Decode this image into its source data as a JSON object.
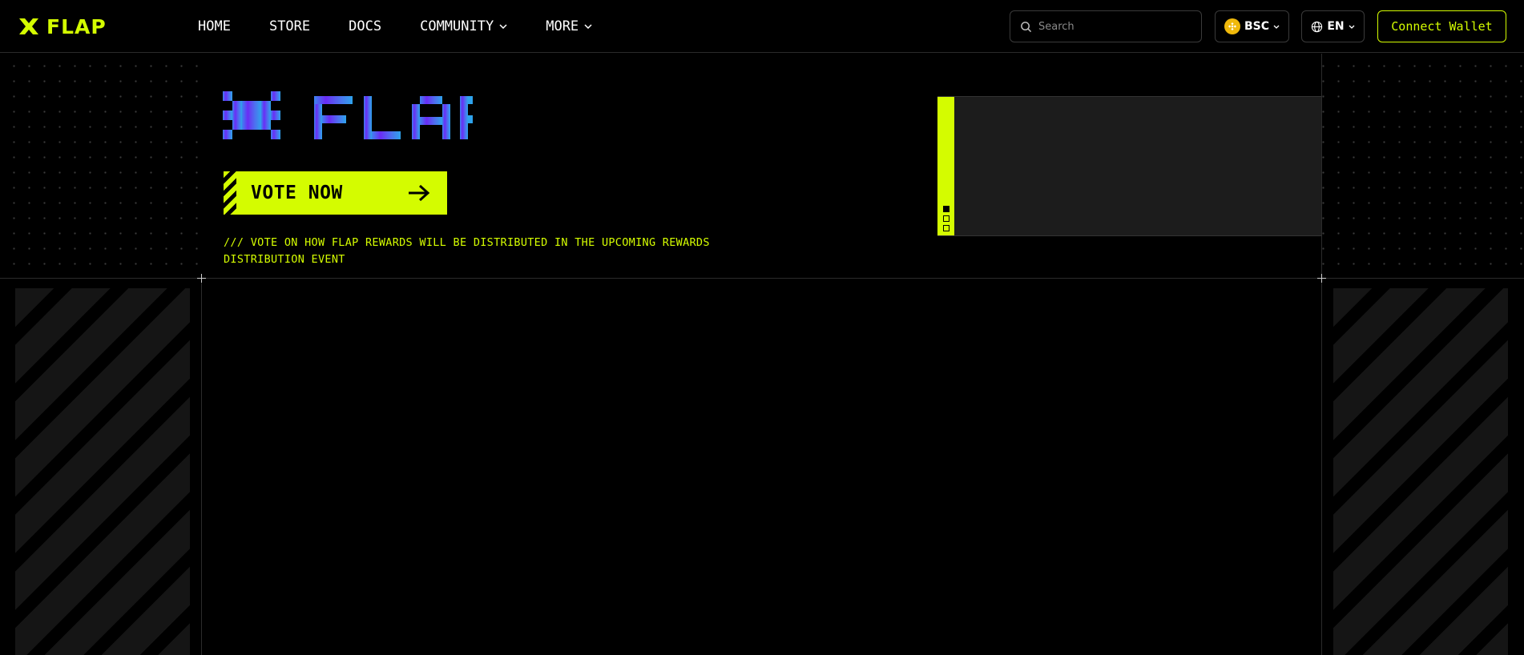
{
  "brand": {
    "name": "FLAP",
    "accent": "#d4fc00",
    "logo_icon": "flap-x-logo-icon"
  },
  "nav": {
    "links": [
      {
        "label": "HOME"
      },
      {
        "label": "STORE"
      },
      {
        "label": "DOCS"
      },
      {
        "label": "COMMUNITY",
        "dropdown": true
      },
      {
        "label": "MORE",
        "dropdown": true
      }
    ],
    "search_placeholder": "Search",
    "chain": {
      "label": "BSC",
      "icon": "bnb-chain-icon"
    },
    "language": {
      "label": "EN",
      "icon": "globe-icon"
    },
    "connect_label": "Connect Wallet"
  },
  "hero": {
    "title": "FLAP",
    "cta_label": "VOTE NOW",
    "cta_icon": "arrow-right-icon",
    "tagline": "/// VOTE ON HOW FLAP REWARDS WILL BE DISTRIBUTED IN THE UPCOMING REWARDS DISTRIBUTION EVENT",
    "slider": {
      "slide_count": 3,
      "active_slide": 1
    }
  },
  "colors": {
    "accent": "#d4fc00",
    "background": "#000000",
    "logo_gradient": [
      "#6a2cf5",
      "#4f6df0",
      "#2ea3ec"
    ]
  }
}
